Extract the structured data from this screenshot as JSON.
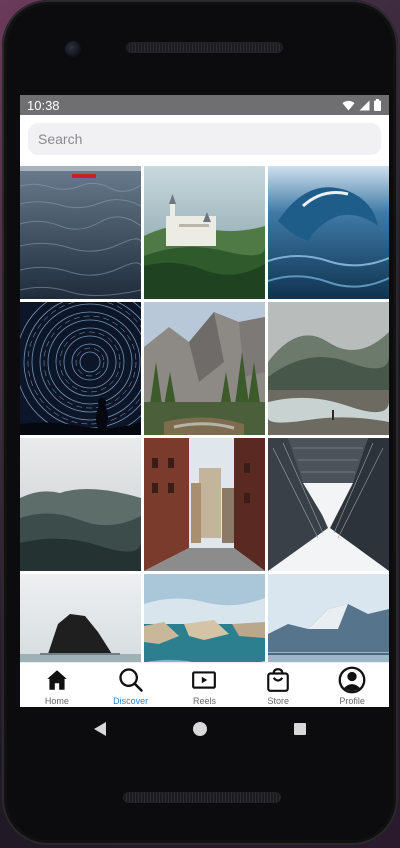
{
  "status": {
    "time": "10:38"
  },
  "search": {
    "placeholder": "Search"
  },
  "tabs": [
    {
      "label": "Home",
      "icon": "home-icon",
      "active": false
    },
    {
      "label": "Discover",
      "icon": "search-icon",
      "active": true
    },
    {
      "label": "Reels",
      "icon": "reels-icon",
      "active": false
    },
    {
      "label": "Store",
      "icon": "shopping-bag-icon",
      "active": false
    },
    {
      "label": "Profile",
      "icon": "profile-icon",
      "active": false
    }
  ],
  "grid_photos": [
    "ocean-waves-boat-photo",
    "castle-on-cliff-photo",
    "curling-wave-photo",
    "star-trails-swirl-photo",
    "valley-cliffs-forest-photo",
    "river-forest-mist-photo",
    "misty-mountain-photo",
    "city-alley-photo",
    "skyscraper-looking-up-photo",
    "rock-island-photo",
    "coastal-cliffs-photo",
    "mountain-lake-photo"
  ],
  "colors": {
    "accent": "#2c86d6",
    "status_bar": "#6f6f72"
  }
}
